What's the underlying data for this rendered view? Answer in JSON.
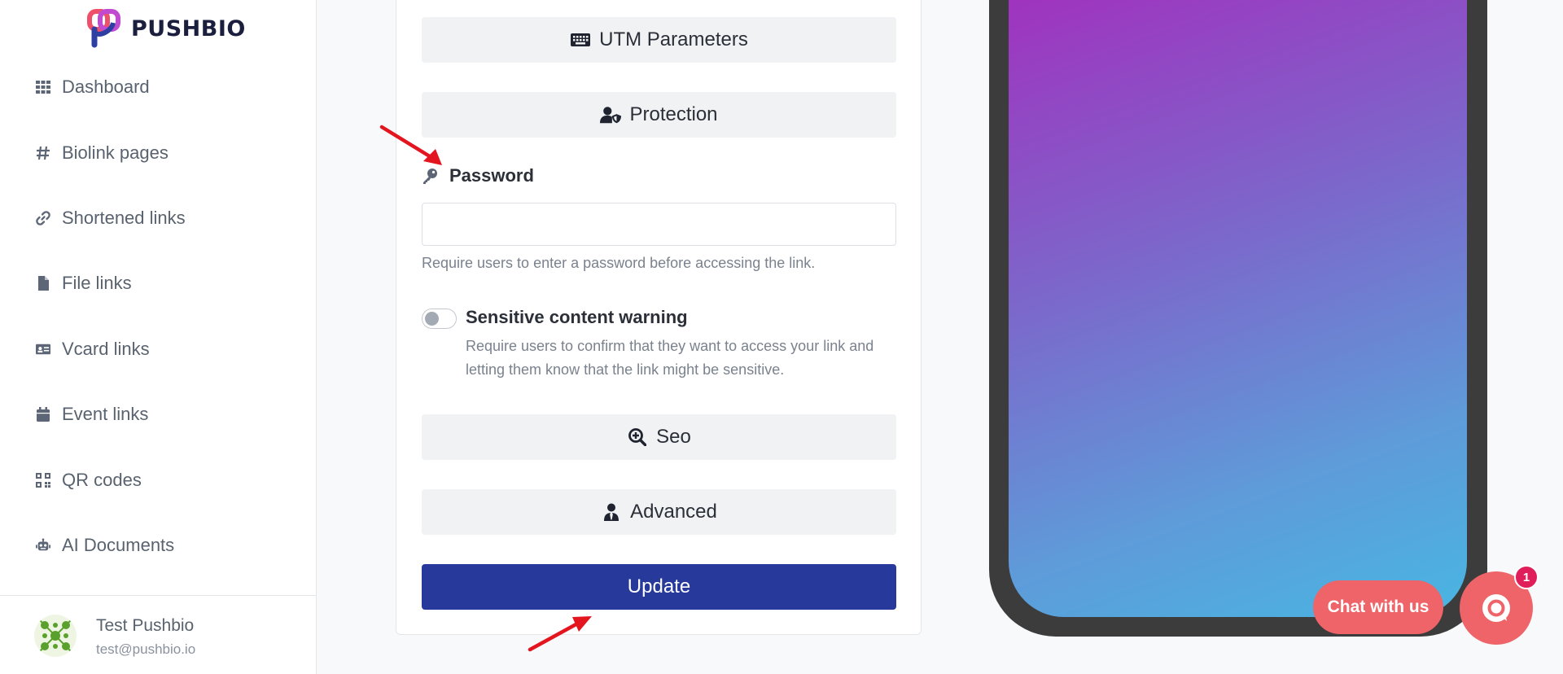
{
  "brand": {
    "name": "PUSHBIO"
  },
  "sidebar": {
    "items": [
      {
        "label": "Dashboard",
        "icon": "grid-icon"
      },
      {
        "label": "Biolink pages",
        "icon": "hashtag-icon"
      },
      {
        "label": "Shortened links",
        "icon": "link-icon"
      },
      {
        "label": "File links",
        "icon": "file-icon"
      },
      {
        "label": "Vcard links",
        "icon": "id-card-icon"
      },
      {
        "label": "Event links",
        "icon": "calendar-icon"
      },
      {
        "label": "QR codes",
        "icon": "qrcode-icon"
      },
      {
        "label": "AI Documents",
        "icon": "robot-icon"
      }
    ],
    "user": {
      "name": "Test Pushbio",
      "email": "test@pushbio.io"
    }
  },
  "form": {
    "utm_label": "UTM Parameters",
    "protection_label": "Protection",
    "password_label": "Password",
    "password_value": "",
    "password_help": "Require users to enter a password before accessing the link.",
    "sensitive_label": "Sensitive content warning",
    "sensitive_enabled": false,
    "sensitive_help": "Require users to confirm that they want to access your link and letting them know that the link might be sensitive.",
    "seo_label": "Seo",
    "advanced_label": "Advanced",
    "update_label": "Update"
  },
  "chat": {
    "label": "Chat with us",
    "badge": "1"
  },
  "colors": {
    "primary": "#27399b",
    "chat": "#ee6469",
    "annotation": "#e3161f"
  }
}
